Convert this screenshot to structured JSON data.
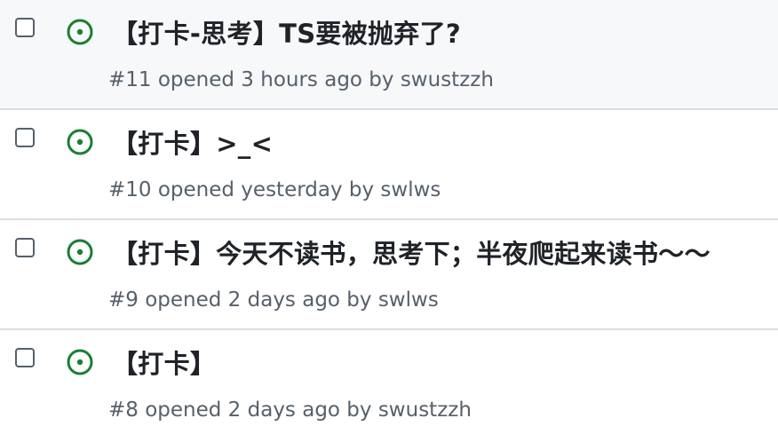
{
  "issues": [
    {
      "title": "【打卡-思考】TS要被抛弃了?",
      "meta": "#11 opened 3 hours ago by swustzzh"
    },
    {
      "title": "【打卡】>_<",
      "meta": "#10 opened yesterday by swlws"
    },
    {
      "title": "【打卡】今天不读书，思考下；半夜爬起来读书～～",
      "meta": "#9 opened 2 days ago by swlws"
    },
    {
      "title": "【打卡】",
      "meta": "#8 opened 2 days ago by swustzzh"
    }
  ],
  "colors": {
    "open_status": "#1a7f37",
    "row_hover": "#f6f8fa",
    "divider": "#d8dee4"
  },
  "icons": {
    "status": "issue-open-icon"
  }
}
